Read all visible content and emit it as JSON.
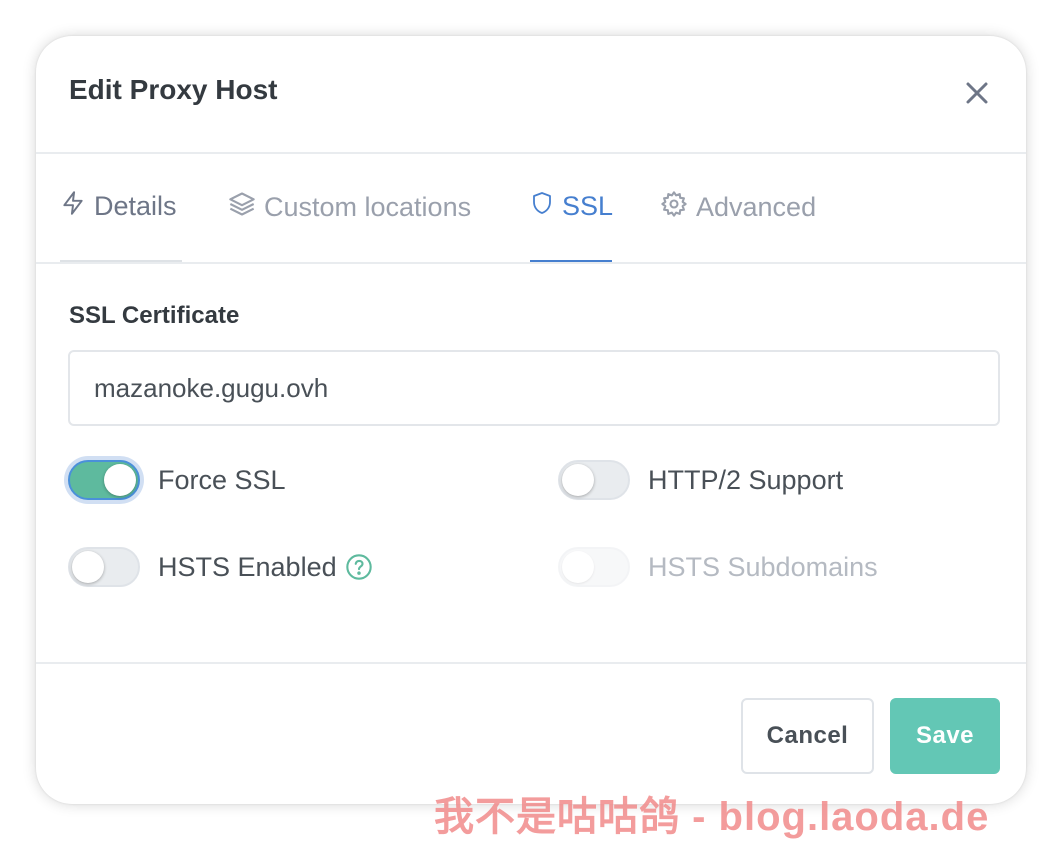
{
  "modal": {
    "title": "Edit Proxy Host",
    "close_icon": "close-icon"
  },
  "tabs": [
    {
      "label": "Details",
      "icon": "lightning-icon",
      "active": false
    },
    {
      "label": "Custom locations",
      "icon": "layers-icon",
      "active": false
    },
    {
      "label": "SSL",
      "icon": "shield-icon",
      "active": true
    },
    {
      "label": "Advanced",
      "icon": "gear-icon",
      "active": false
    }
  ],
  "ssl": {
    "certificate_label": "SSL Certificate",
    "certificate_value": "mazanoke.gugu.ovh",
    "options": [
      {
        "label": "Force SSL",
        "enabled": true,
        "disabled": false
      },
      {
        "label": "HTTP/2 Support",
        "enabled": false,
        "disabled": false
      },
      {
        "label": "HSTS Enabled",
        "enabled": false,
        "disabled": false,
        "help_icon": "question-circle-icon"
      },
      {
        "label": "HSTS Subdomains",
        "enabled": false,
        "disabled": true
      }
    ]
  },
  "footer": {
    "cancel_label": "Cancel",
    "save_label": "Save"
  },
  "watermark": "我不是咕咕鸽 - blog.laoda.de",
  "colors": {
    "accent": "#467fcf",
    "toggle_on": "#5eba9e",
    "save_button": "#63c7b5",
    "watermark": "#f18b8b"
  }
}
